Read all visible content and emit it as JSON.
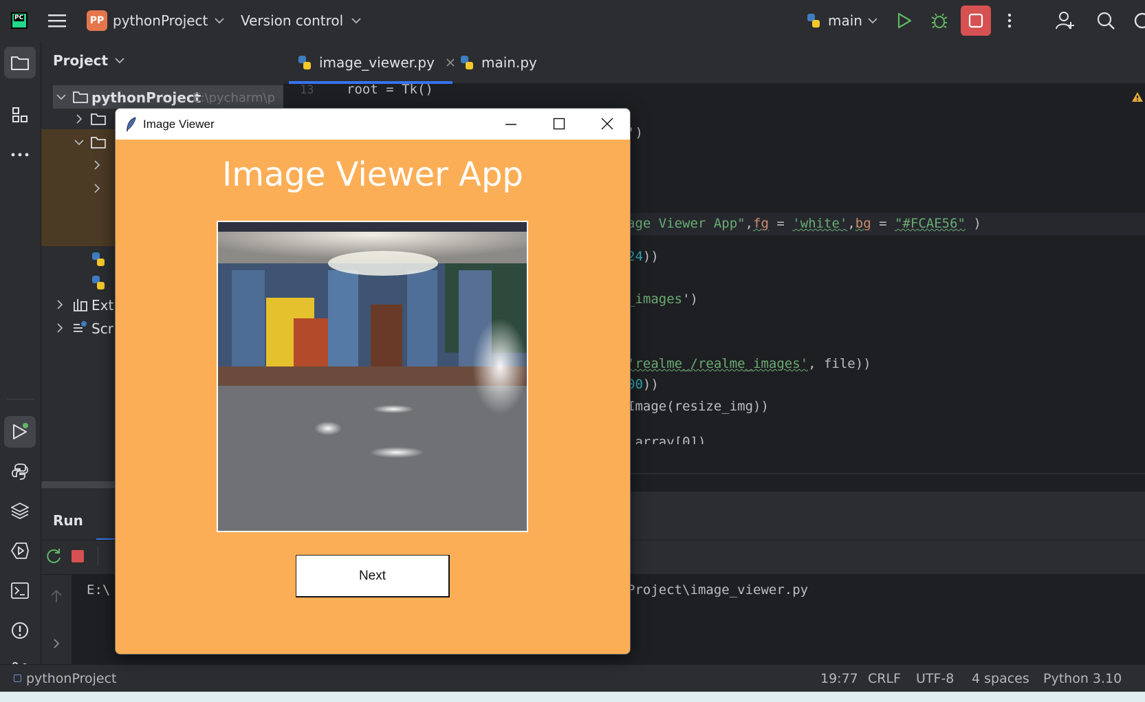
{
  "topbar": {
    "logo": "PC",
    "project_badge": "PP",
    "project_name": "pythonProject",
    "version_control": "Version control",
    "run_config": "main"
  },
  "project_panel": {
    "title": "Project",
    "root_name": "pythonProject",
    "root_path": "E:\\pycharm\\p",
    "external_libs": "Ext",
    "scratches": "Scr"
  },
  "editor": {
    "tabs": [
      {
        "label": "image_viewer.py",
        "active": true
      },
      {
        "label": "main.py",
        "active": false
      }
    ],
    "line_number": "13",
    "lines": {
      "l1": "root = Tk()",
      "l3": "')",
      "l_title_a": "age Viewer App\"",
      "l_title_fg": "fg",
      "l_title_eq": " = ",
      "l_title_white": "'white'",
      "l_title_bg": "bg",
      "l_title_color": "\"#FCAE56\"",
      "l_title_end": " )",
      "l_font": "24",
      "l_font_end": "))",
      "l_dir_a": "_images",
      "l_dir_b": "')",
      "l_join_a": "'realme_/realme_images'",
      "l_join_b": ", file))",
      "l_resize_a": "00",
      "l_resize_b": "))",
      "l_photo": "Image(resize_img))",
      "l_last": "_array[0])"
    }
  },
  "run_panel": {
    "title": "Run",
    "console_left": "E:\\",
    "console_right": "Project\\image_viewer.py"
  },
  "statusbar": {
    "project": "pythonProject",
    "position": "19:77",
    "line_sep": "CRLF",
    "encoding": "UTF-8",
    "indent": "4 spaces",
    "interpreter": "Python 3.10"
  },
  "tk_window": {
    "title": "Image Viewer",
    "heading": "Image Viewer App",
    "next_button": "Next",
    "bg_color": "#FCAE56"
  },
  "colors": {
    "ide_bg": "#1e1f22",
    "ide_panel": "#2b2d30",
    "accent_green": "#5fb865",
    "stop_red": "#d65151"
  }
}
